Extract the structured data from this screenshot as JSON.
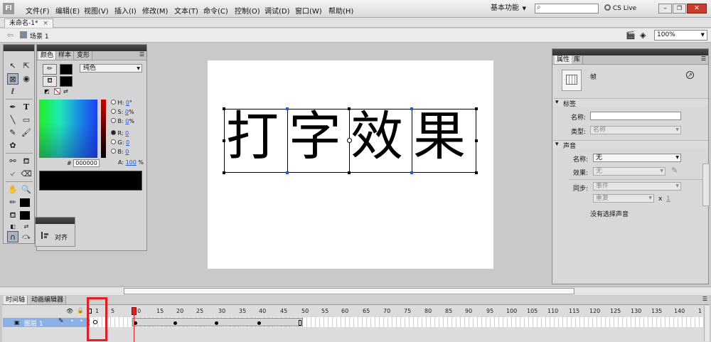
{
  "app": {
    "logo": "Fl"
  },
  "menu": {
    "items": [
      "文件(F)",
      "编辑(E)",
      "视图(V)",
      "插入(I)",
      "修改(M)",
      "文本(T)",
      "命令(C)",
      "控制(O)",
      "调试(D)",
      "窗口(W)",
      "帮助(H)"
    ]
  },
  "workspace": {
    "label": "基本功能"
  },
  "search": {
    "placeholder": "",
    "icon": "search-icon"
  },
  "cslive": {
    "label": "CS Live"
  },
  "document": {
    "tab": "未命名-1*"
  },
  "scene": {
    "label": "场景 1",
    "zoom": "100%"
  },
  "color_panel": {
    "tabs": [
      "颜色",
      "样本",
      "变形"
    ],
    "fill_type": "纯色",
    "hsb": [
      {
        "key": "H:",
        "val": "0",
        "unit": "°"
      },
      {
        "key": "S:",
        "val": "0",
        "unit": "%"
      },
      {
        "key": "B:",
        "val": "0",
        "unit": "%"
      }
    ],
    "rgb": [
      {
        "key": "R:",
        "val": "0"
      },
      {
        "key": "G:",
        "val": "0"
      },
      {
        "key": "B:",
        "val": "0"
      }
    ],
    "alpha": {
      "key": "A:",
      "val": "100",
      "unit": "%"
    },
    "hex": {
      "prefix": "#",
      "val": "000000"
    }
  },
  "align_panel": {
    "label": "对齐"
  },
  "stage_text": [
    "打",
    "字",
    "效",
    "果"
  ],
  "properties": {
    "tabs": [
      "属性",
      "库"
    ],
    "type_label": "帧",
    "label_section": "标签",
    "name_label": "名称:",
    "name_value": "",
    "type_field_label": "类型:",
    "type_value": "名称",
    "sound_section": "声音",
    "sound_name_label": "名称:",
    "sound_name_value": "无",
    "effect_label": "效果:",
    "effect_value": "无",
    "sync_label": "同步:",
    "sync_value": "事件",
    "repeat_value": "重复",
    "repeat_x": "x",
    "repeat_count": "1",
    "no_sound": "没有选择声音"
  },
  "timeline": {
    "tabs": [
      "时间轴",
      "动画编辑器"
    ],
    "layer_name": "图层 1",
    "ticks": [
      "1",
      "5",
      "10",
      "15",
      "20",
      "25",
      "30",
      "35",
      "40",
      "45",
      "50",
      "55",
      "60",
      "65",
      "70",
      "75",
      "80",
      "85",
      "90",
      "95",
      "100",
      "105",
      "110",
      "115",
      "120",
      "125",
      "130",
      "135",
      "140",
      "1"
    ],
    "playhead": "10"
  },
  "colors": {
    "accent_red": "#e51c23",
    "selection_blue": "#1d5bd8",
    "layer_row": "#8bb0e6"
  }
}
